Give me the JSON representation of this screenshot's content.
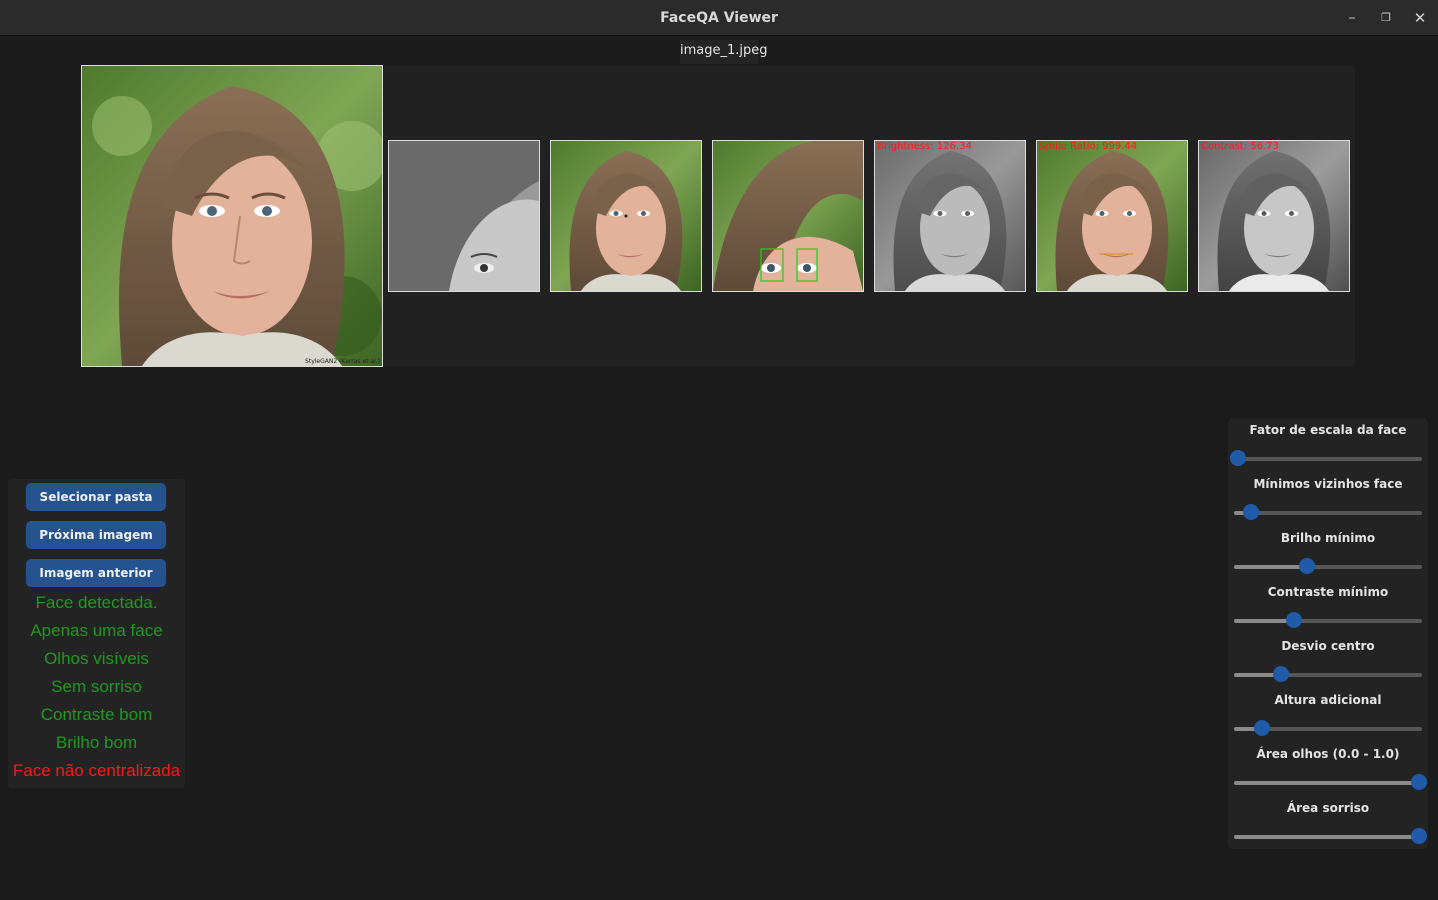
{
  "window": {
    "title": "FaceQA Viewer",
    "minimize_glyph": "–",
    "maximize_glyph": "❐",
    "close_glyph": "✕"
  },
  "image": {
    "filename": "image_1.jpeg",
    "watermark": "StyleGAN2 (Karras et al.)",
    "thumb_labels": {
      "brightness": "Brightness: 126.34",
      "smile": "Smile Ratio: 999.44",
      "contrast": "Contrast: 56.73"
    }
  },
  "buttons": {
    "select_folder": "Selecionar pasta",
    "next_image": "Próxima imagem",
    "prev_image": "Imagem anterior"
  },
  "status": [
    {
      "text": "Face detectada.",
      "ok": true
    },
    {
      "text": "Apenas uma face",
      "ok": true
    },
    {
      "text": "Olhos visíveis",
      "ok": true
    },
    {
      "text": "Sem sorriso",
      "ok": true
    },
    {
      "text": "Contraste bom",
      "ok": true
    },
    {
      "text": "Brilho bom",
      "ok": true
    },
    {
      "text": "Face não centralizada",
      "ok": false
    }
  ],
  "sliders": [
    {
      "label": "Fator de escala da face",
      "value": 0.02
    },
    {
      "label": "Mínimos vizinhos face",
      "value": 0.09
    },
    {
      "label": "Brilho mínimo",
      "value": 0.39
    },
    {
      "label": "Contraste mínimo",
      "value": 0.32
    },
    {
      "label": "Desvio centro",
      "value": 0.25
    },
    {
      "label": "Altura adicional",
      "value": 0.15
    },
    {
      "label": "Área olhos (0.0 - 1.0)",
      "value": 1.0
    },
    {
      "label": "Área sorriso",
      "value": 1.0
    }
  ],
  "colors": {
    "accent": "#1f5ba8",
    "button": "#24538f",
    "ok": "#1f9a1f",
    "bad": "#ff1616"
  }
}
